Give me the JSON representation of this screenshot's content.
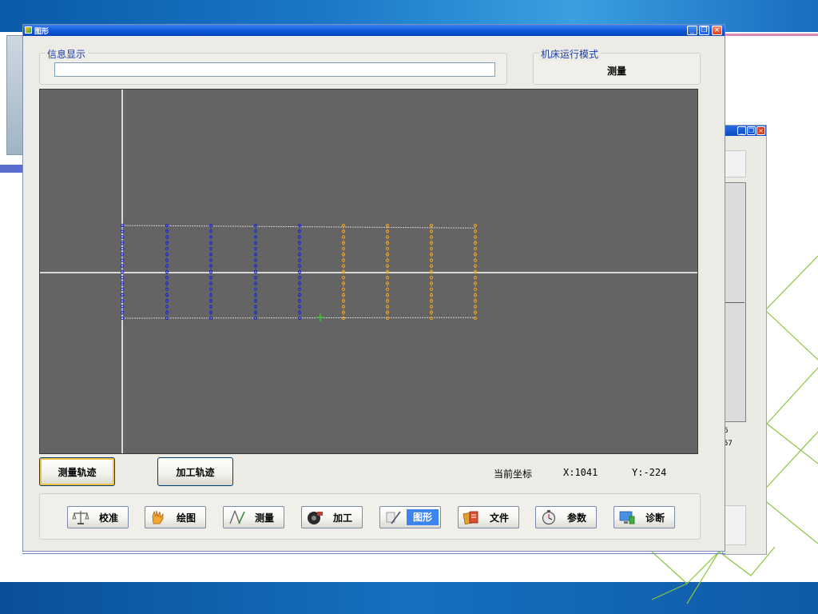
{
  "window": {
    "title": "图形"
  },
  "info_group": {
    "legend": "信息显示",
    "message": ""
  },
  "mode_group": {
    "legend": "机床运行模式",
    "value": "测量"
  },
  "track_buttons": {
    "measure": "测量轨迹",
    "machine": "加工轨迹"
  },
  "coords": {
    "label": "当前坐标",
    "x": "X:1041",
    "y": "Y:-224"
  },
  "nav": {
    "items": [
      {
        "label": "校准",
        "icon": "balance-scale-icon"
      },
      {
        "label": "绘图",
        "icon": "hand-draw-icon"
      },
      {
        "label": "测量",
        "icon": "compass-measure-icon"
      },
      {
        "label": "加工",
        "icon": "machining-icon"
      },
      {
        "label": "图形",
        "icon": "graphics-icon",
        "active": true
      },
      {
        "label": "文件",
        "icon": "file-icon"
      },
      {
        "label": "参数",
        "icon": "stopwatch-icon"
      },
      {
        "label": "诊断",
        "icon": "monitor-diagnose-icon"
      }
    ]
  },
  "background_window": {
    "labels": [
      "6",
      "57"
    ]
  },
  "colors": {
    "canvas": "#646464",
    "measure_point": "#1a2ad8",
    "machine_point": "#f0a020",
    "axis": "#ffffff",
    "cursor": "#40c040",
    "active_nav": "#3c84ee"
  }
}
